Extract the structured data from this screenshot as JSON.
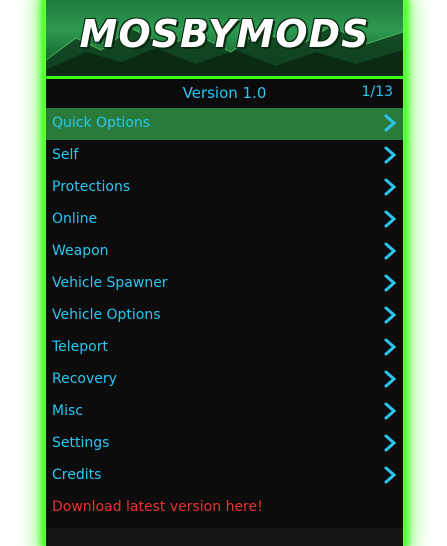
{
  "header": {
    "logo_text": "MOSBYMODS",
    "version": "Version 1.0",
    "counter": "1/13"
  },
  "menu": {
    "items": [
      {
        "label": "Quick Options",
        "selected": true
      },
      {
        "label": "Self"
      },
      {
        "label": "Protections"
      },
      {
        "label": "Online"
      },
      {
        "label": "Weapon"
      },
      {
        "label": "Vehicle Spawner"
      },
      {
        "label": "Vehicle Options"
      },
      {
        "label": "Teleport"
      },
      {
        "label": "Recovery"
      },
      {
        "label": "Misc"
      },
      {
        "label": "Settings"
      },
      {
        "label": "Credits"
      }
    ],
    "download_label": "Download latest version here!"
  },
  "colors": {
    "glow": "#39ff14",
    "text": "#29c6f3",
    "selected_bg": "#2a7a3a",
    "download_text": "#e8322f",
    "panel_bg": "#0c0c0c"
  },
  "icons": {
    "submenu": "chevron-right-icon"
  }
}
